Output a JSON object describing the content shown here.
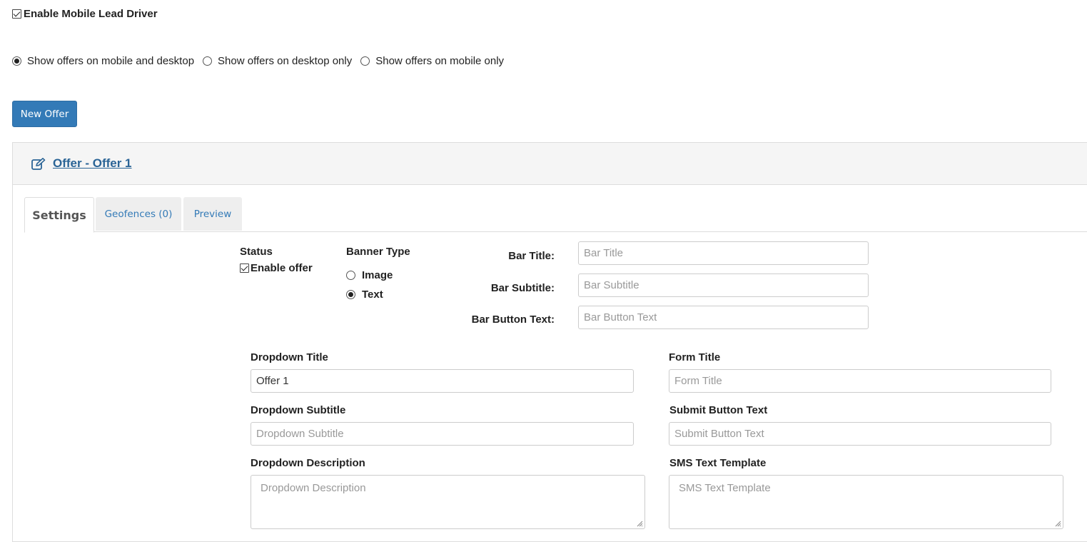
{
  "mobile_lead_driver": {
    "label": "Enable Mobile Lead Driver",
    "checked": true
  },
  "display_options": [
    {
      "label": "Show offers on mobile and desktop",
      "selected": true
    },
    {
      "label": "Show offers on desktop only",
      "selected": false
    },
    {
      "label": "Show offers on mobile only",
      "selected": false
    }
  ],
  "new_offer_button": {
    "label": "New Offer"
  },
  "offer_panel": {
    "title": "Offer - Offer 1",
    "tabs": [
      {
        "label": "Settings",
        "active": true
      },
      {
        "label": "Geofences (0)",
        "active": false
      },
      {
        "label": "Preview",
        "active": false
      }
    ]
  },
  "settings": {
    "status": {
      "heading": "Status",
      "enable_label": "Enable offer",
      "enabled": true
    },
    "banner_type": {
      "heading": "Banner Type",
      "options": [
        {
          "label": "Image",
          "selected": false
        },
        {
          "label": "Text",
          "selected": true
        }
      ]
    },
    "bar_title": {
      "label": "Bar Title:",
      "value": "",
      "placeholder": "Bar Title"
    },
    "bar_subtitle": {
      "label": "Bar Subtitle:",
      "value": "",
      "placeholder": "Bar Subtitle"
    },
    "bar_button_text": {
      "label": "Bar Button Text:",
      "value": "",
      "placeholder": "Bar Button Text"
    },
    "dropdown_title": {
      "label": "Dropdown Title",
      "value": "Offer 1",
      "placeholder": ""
    },
    "dropdown_subtitle": {
      "label": "Dropdown Subtitle",
      "value": "",
      "placeholder": "Dropdown Subtitle"
    },
    "dropdown_description": {
      "label": "Dropdown Description",
      "value": "",
      "placeholder": "Dropdown Description"
    },
    "form_title": {
      "label": "Form Title",
      "value": "",
      "placeholder": "Form Title"
    },
    "submit_button_text": {
      "label": "Submit Button Text",
      "value": "",
      "placeholder": "Submit Button Text"
    },
    "sms_text_template": {
      "label": "SMS Text Template",
      "value": "",
      "placeholder": "SMS Text Template"
    }
  },
  "colors": {
    "primary": "#337ab7",
    "link": "#2a6496",
    "panel_header": "#f5f5f5",
    "border": "#dddddd"
  },
  "icons": {
    "offer_edit": "edit-icon",
    "textarea_resize": "resize-grip-icon"
  }
}
